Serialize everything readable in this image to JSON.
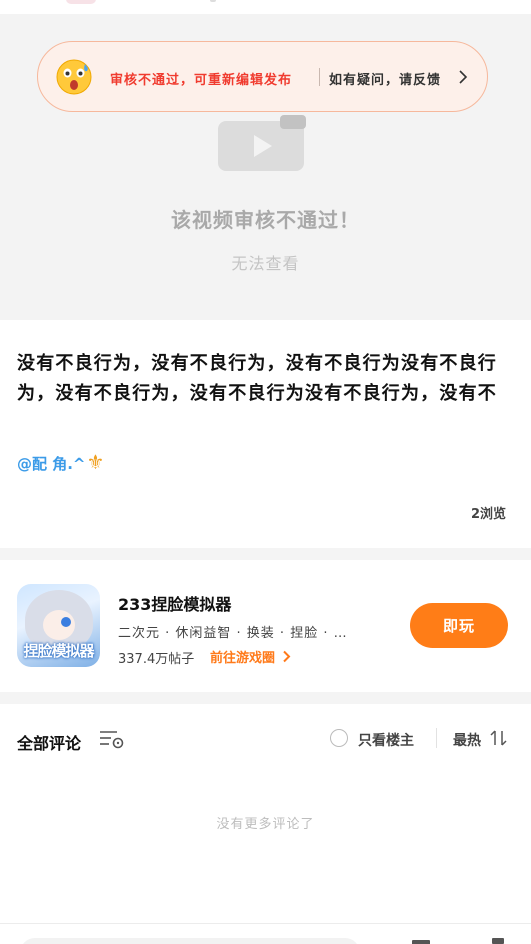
{
  "banner": {
    "main_text": "审核不通过，可重新编辑发布",
    "feedback_text": "如有疑问，请反馈"
  },
  "video": {
    "title": "该视频审核不通过！",
    "subtitle": "无法查看"
  },
  "post": {
    "text": "没有不良行为，没有不良行为，没有不良行为没有不良行为，没有不良行为，没有不良行为没有不良行为，没有不",
    "mention": "@配   角.^",
    "mention_emoji": "⚜",
    "views": "2浏览"
  },
  "game": {
    "icon_label": "捏脸模拟器",
    "name": "233捏脸模拟器",
    "tags": "二次元 · 休闲益智 · 换装 · 捏脸 · …",
    "posts": "337.4万帖子",
    "circle_link": "前往游戏圈",
    "play_button": "即玩"
  },
  "comments": {
    "title": "全部评论",
    "only_op": "只看楼主",
    "sort": "最热",
    "empty": "没有更多评论了"
  },
  "colors": {
    "accent": "#ff7d17",
    "banner_red": "#f03b2f",
    "mention_blue": "#3b9be8"
  }
}
